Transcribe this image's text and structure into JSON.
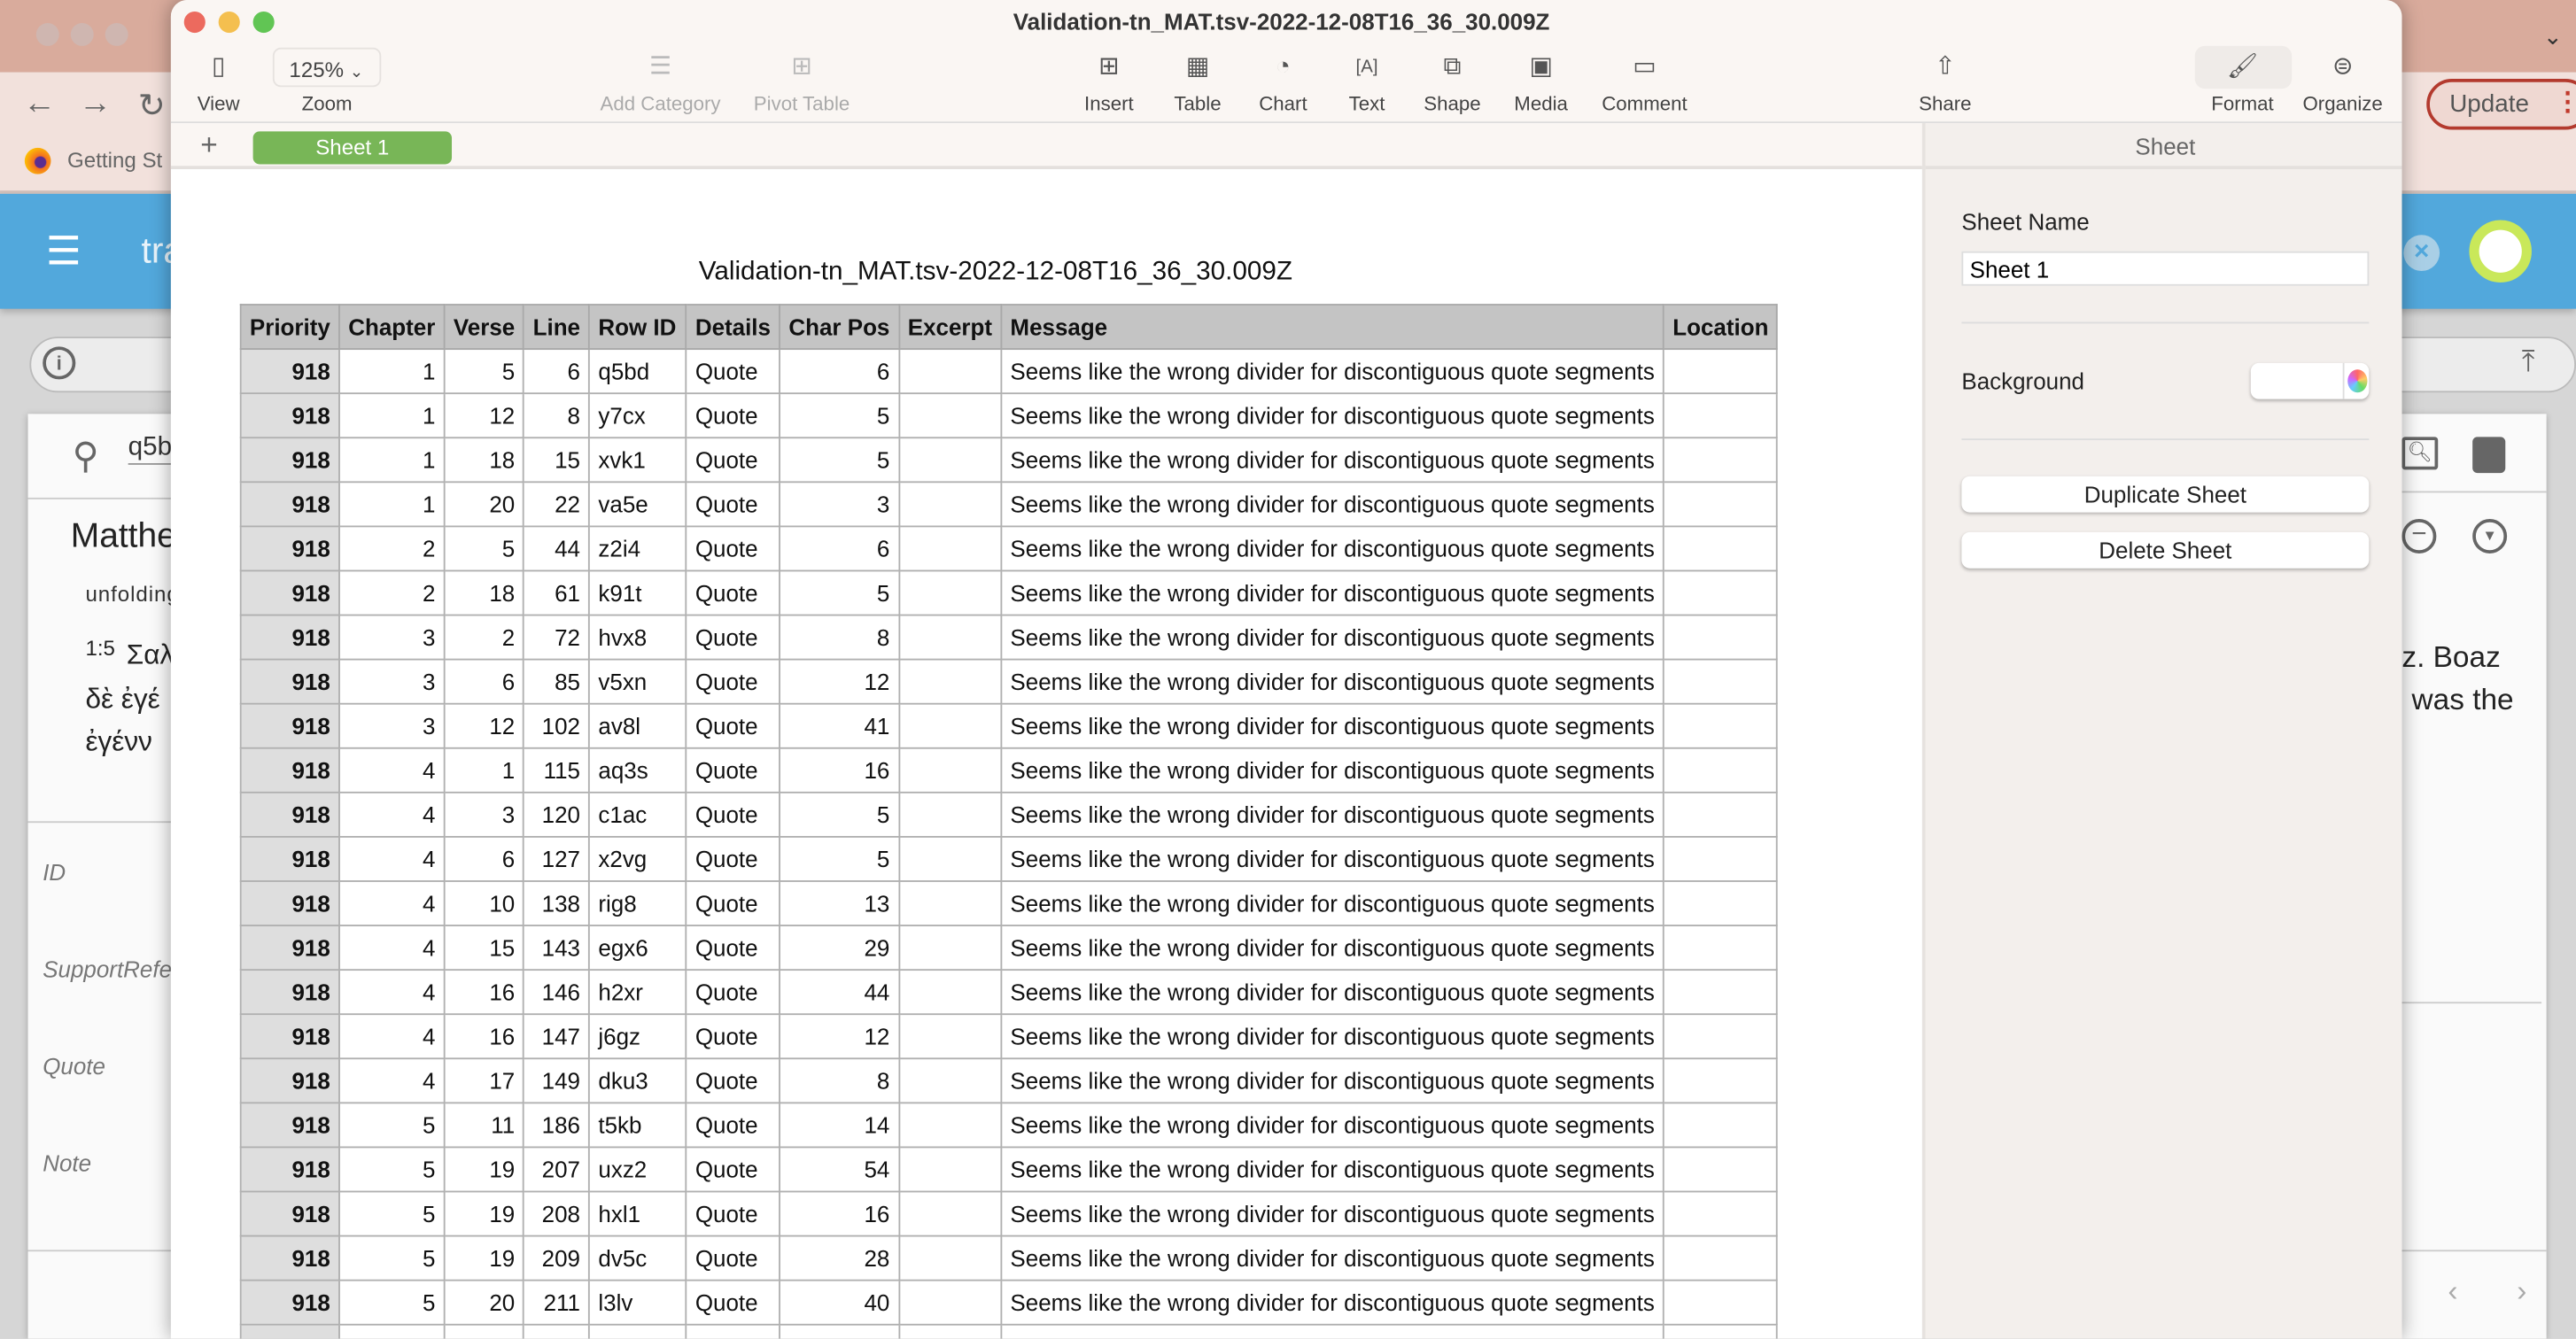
{
  "window": {
    "title": "Validation-tn_MAT.tsv-2022-12-08T16_36_30.009Z"
  },
  "toolbar": {
    "zoom_value": "125%",
    "items": [
      {
        "label": "View",
        "icon": "sidebar-icon"
      },
      {
        "label": "Zoom",
        "icon": "zoom-dropdown"
      },
      {
        "label": "Add Category",
        "icon": "list-icon",
        "disabled": true
      },
      {
        "label": "Pivot Table",
        "icon": "pivot-table-icon",
        "disabled": true
      },
      {
        "label": "Insert",
        "icon": "insert-icon"
      },
      {
        "label": "Table",
        "icon": "table-icon"
      },
      {
        "label": "Chart",
        "icon": "chart-icon"
      },
      {
        "label": "Text",
        "icon": "text-box-icon"
      },
      {
        "label": "Shape",
        "icon": "shape-icon"
      },
      {
        "label": "Media",
        "icon": "media-icon"
      },
      {
        "label": "Comment",
        "icon": "comment-icon"
      },
      {
        "label": "Share",
        "icon": "share-icon"
      },
      {
        "label": "Format",
        "icon": "paintbrush-icon",
        "active": true
      },
      {
        "label": "Organize",
        "icon": "organize-icon"
      }
    ]
  },
  "tabs": {
    "add": "+",
    "sheets": [
      "Sheet 1"
    ],
    "active_color": "#78b657"
  },
  "sidebar": {
    "header": "Sheet",
    "sheet_name_label": "Sheet Name",
    "sheet_name_value": "Sheet 1",
    "background_label": "Background",
    "background_color": "#ffffff",
    "duplicate": "Duplicate Sheet",
    "delete": "Delete Sheet"
  },
  "sheet": {
    "title": "Validation-tn_MAT.tsv-2022-12-08T16_36_30.009Z",
    "columns": [
      "Priority",
      "Chapter",
      "Verse",
      "Line",
      "Row ID",
      "Details",
      "Char Pos",
      "Excerpt",
      "Message",
      "Location"
    ],
    "rows": [
      [
        "918",
        "1",
        "5",
        "6",
        "q5bd",
        "Quote",
        "6",
        "",
        "Seems like the wrong divider for discontiguous quote segments",
        ""
      ],
      [
        "918",
        "1",
        "12",
        "8",
        "y7cx",
        "Quote",
        "5",
        "",
        "Seems like the wrong divider for discontiguous quote segments",
        ""
      ],
      [
        "918",
        "1",
        "18",
        "15",
        "xvk1",
        "Quote",
        "5",
        "",
        "Seems like the wrong divider for discontiguous quote segments",
        ""
      ],
      [
        "918",
        "1",
        "20",
        "22",
        "va5e",
        "Quote",
        "3",
        "",
        "Seems like the wrong divider for discontiguous quote segments",
        ""
      ],
      [
        "918",
        "2",
        "5",
        "44",
        "z2i4",
        "Quote",
        "6",
        "",
        "Seems like the wrong divider for discontiguous quote segments",
        ""
      ],
      [
        "918",
        "2",
        "18",
        "61",
        "k91t",
        "Quote",
        "5",
        "",
        "Seems like the wrong divider for discontiguous quote segments",
        ""
      ],
      [
        "918",
        "3",
        "2",
        "72",
        "hvx8",
        "Quote",
        "8",
        "",
        "Seems like the wrong divider for discontiguous quote segments",
        ""
      ],
      [
        "918",
        "3",
        "6",
        "85",
        "v5xn",
        "Quote",
        "12",
        "",
        "Seems like the wrong divider for discontiguous quote segments",
        ""
      ],
      [
        "918",
        "3",
        "12",
        "102",
        "av8l",
        "Quote",
        "41",
        "",
        "Seems like the wrong divider for discontiguous quote segments",
        ""
      ],
      [
        "918",
        "4",
        "1",
        "115",
        "aq3s",
        "Quote",
        "16",
        "",
        "Seems like the wrong divider for discontiguous quote segments",
        ""
      ],
      [
        "918",
        "4",
        "3",
        "120",
        "c1ac",
        "Quote",
        "5",
        "",
        "Seems like the wrong divider for discontiguous quote segments",
        ""
      ],
      [
        "918",
        "4",
        "6",
        "127",
        "x2vg",
        "Quote",
        "5",
        "",
        "Seems like the wrong divider for discontiguous quote segments",
        ""
      ],
      [
        "918",
        "4",
        "10",
        "138",
        "rig8",
        "Quote",
        "13",
        "",
        "Seems like the wrong divider for discontiguous quote segments",
        ""
      ],
      [
        "918",
        "4",
        "15",
        "143",
        "egx6",
        "Quote",
        "29",
        "",
        "Seems like the wrong divider for discontiguous quote segments",
        ""
      ],
      [
        "918",
        "4",
        "16",
        "146",
        "h2xr",
        "Quote",
        "44",
        "",
        "Seems like the wrong divider for discontiguous quote segments",
        ""
      ],
      [
        "918",
        "4",
        "16",
        "147",
        "j6gz",
        "Quote",
        "12",
        "",
        "Seems like the wrong divider for discontiguous quote segments",
        ""
      ],
      [
        "918",
        "4",
        "17",
        "149",
        "dku3",
        "Quote",
        "8",
        "",
        "Seems like the wrong divider for discontiguous quote segments",
        ""
      ],
      [
        "918",
        "5",
        "11",
        "186",
        "t5kb",
        "Quote",
        "14",
        "",
        "Seems like the wrong divider for discontiguous quote segments",
        ""
      ],
      [
        "918",
        "5",
        "19",
        "207",
        "uxz2",
        "Quote",
        "54",
        "",
        "Seems like the wrong divider for discontiguous quote segments",
        ""
      ],
      [
        "918",
        "5",
        "19",
        "208",
        "hxl1",
        "Quote",
        "16",
        "",
        "Seems like the wrong divider for discontiguous quote segments",
        ""
      ],
      [
        "918",
        "5",
        "19",
        "209",
        "dv5c",
        "Quote",
        "28",
        "",
        "Seems like the wrong divider for discontiguous quote segments",
        ""
      ],
      [
        "918",
        "5",
        "20",
        "211",
        "l3lv",
        "Quote",
        "40",
        "",
        "Seems like the wrong divider for discontiguous quote segments",
        ""
      ]
    ]
  },
  "background_browser": {
    "bookmark": "Getting St",
    "app_title": "tra",
    "search_value": "q5b",
    "book": "Matthe",
    "subtitle": "unfolding",
    "verse_ref": "1:5",
    "verse_lines": [
      "Σαλ",
      "δὲ ἐγέ",
      "ἐγένν"
    ],
    "fields": [
      "ID",
      "SupportRefe",
      "Quote",
      "Note"
    ],
    "update_button": "Update",
    "right_text": [
      "z. Boaz",
      "was the"
    ]
  }
}
